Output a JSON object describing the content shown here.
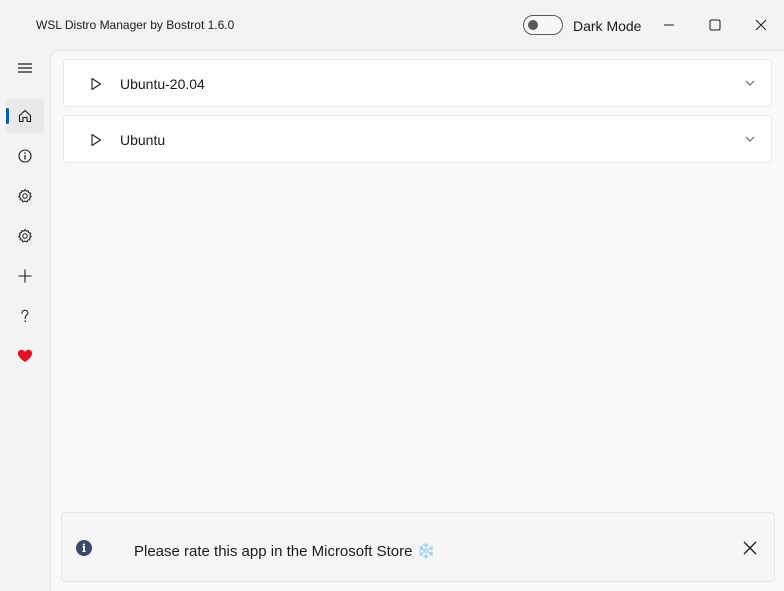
{
  "window": {
    "title": "WSL Distro Manager by Bostrot 1.6.0",
    "dark_mode_label": "Dark Mode",
    "dark_mode_on": false
  },
  "sidebar": {
    "items": [
      {
        "name": "menu",
        "icon": "hamburger-icon",
        "selected": false
      },
      {
        "name": "home",
        "icon": "home-icon",
        "selected": true
      },
      {
        "name": "info",
        "icon": "info-icon",
        "selected": false
      },
      {
        "name": "settings",
        "icon": "gear-icon",
        "selected": false
      },
      {
        "name": "settings-2",
        "icon": "gear-icon",
        "selected": false
      },
      {
        "name": "add",
        "icon": "plus-icon",
        "selected": false
      },
      {
        "name": "help",
        "icon": "question-icon",
        "selected": false
      },
      {
        "name": "donate",
        "icon": "heart-icon",
        "selected": false
      }
    ],
    "accent": "#005fb8",
    "heart_color": "#e81123"
  },
  "distros": [
    {
      "name": "Ubuntu-20.04"
    },
    {
      "name": "Ubuntu"
    }
  ],
  "infobar": {
    "message": "Please rate this app in the Microsoft Store ❄️",
    "icon": "info-icon"
  }
}
